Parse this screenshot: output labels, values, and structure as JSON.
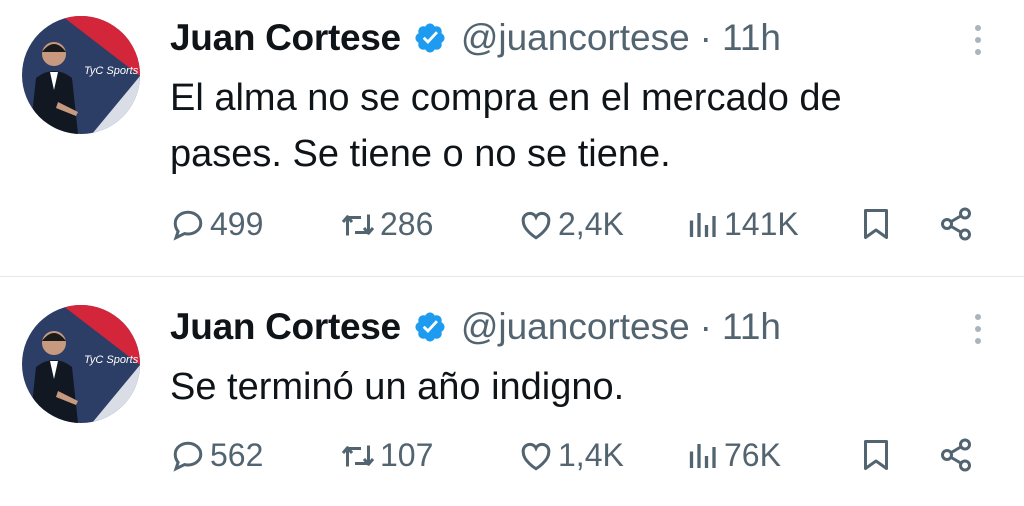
{
  "tweets": [
    {
      "author_name": "Juan Cortese",
      "handle": "@juancortese",
      "separator": "·",
      "time": "11h",
      "avatar_logo_text": "TyC Sports",
      "text": "El alma no se compra en el mercado de pases. Se tiene o no se tiene.",
      "replies": "499",
      "reposts": "286",
      "likes": "2,4K",
      "views": "141K"
    },
    {
      "author_name": "Juan Cortese",
      "handle": "@juancortese",
      "separator": "·",
      "time": "11h",
      "avatar_logo_text": "TyC Sports",
      "text": "Se terminó un año indigno.",
      "replies": "562",
      "reposts": "107",
      "likes": "1,4K",
      "views": "76K"
    }
  ],
  "colors": {
    "verified": "#1d9bf0",
    "secondary_text": "#536471",
    "primary_text": "#0f1419"
  },
  "icons": [
    "verified-badge-icon",
    "more-options-icon",
    "reply-icon",
    "repost-icon",
    "like-icon",
    "views-icon",
    "bookmark-icon",
    "share-icon"
  ]
}
